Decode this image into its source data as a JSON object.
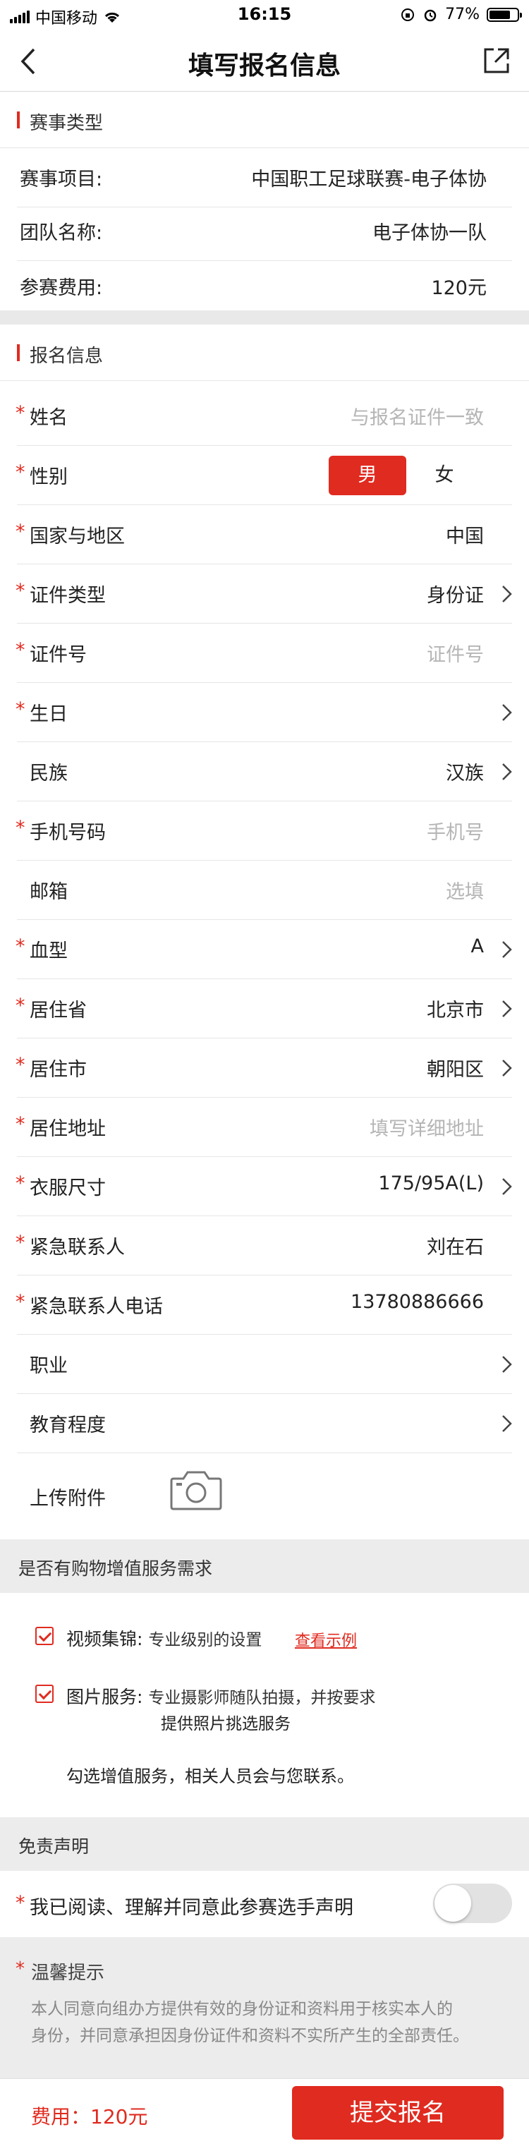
{
  "status_bar": {
    "carrier": "中国移动",
    "time": "16:15",
    "battery": "77%",
    "battery_level": 0.77
  },
  "nav": {
    "title": "填写报名信息",
    "back_icon": "chevron-left-icon",
    "share_icon": "share-external-icon"
  },
  "event_section": {
    "title": "赛事类型",
    "rows": [
      {
        "label": "赛事项目:",
        "value": "中国职工足球联赛-电子体协"
      },
      {
        "label": "团队名称:",
        "value": "电子体协一队"
      },
      {
        "label": "参赛费用:",
        "value": "120元"
      }
    ]
  },
  "signup_section": {
    "title": "报名信息",
    "required_mark": "*",
    "name": {
      "label": "姓名",
      "placeholder": "与报名证件一致"
    },
    "gender": {
      "label": "性别",
      "options": [
        "男",
        "女"
      ],
      "selected": "男"
    },
    "country": {
      "label": "国家与地区",
      "value": "中国"
    },
    "id_type": {
      "label": "证件类型",
      "value": "身份证"
    },
    "id_number": {
      "label": "证件号",
      "placeholder": "证件号"
    },
    "birthday": {
      "label": "生日",
      "value": ""
    },
    "ethnicity": {
      "label": "民族",
      "value": "汉族"
    },
    "phone": {
      "label": "手机号码",
      "placeholder": "手机号"
    },
    "email": {
      "label": "邮箱",
      "placeholder": "选填"
    },
    "blood_type": {
      "label": "血型",
      "value": "A"
    },
    "province": {
      "label": "居住省",
      "value": "北京市"
    },
    "city": {
      "label": "居住市",
      "value": "朝阳区"
    },
    "address": {
      "label": "居住地址",
      "placeholder": "填写详细地址"
    },
    "clothing_size": {
      "label": "衣服尺寸",
      "value": "175/95A(L)"
    },
    "emergency_contact": {
      "label": "紧急联系人",
      "value": "刘在石"
    },
    "emergency_phone": {
      "label": "紧急联系人电话",
      "value": "13780886666"
    },
    "occupation": {
      "label": "职业",
      "value": ""
    },
    "education": {
      "label": "教育程度",
      "value": ""
    },
    "attachment": {
      "label": "上传附件",
      "icon": "camera-icon"
    }
  },
  "value_added": {
    "title": "是否有购物增值服务需求",
    "video": {
      "key": "视频集锦:",
      "desc": "专业级别的设置",
      "link": "查看示例",
      "checked": true
    },
    "photo": {
      "key": "图片服务:",
      "desc_line1": "专业摄影师随队拍摄，并按要求",
      "desc_line2": "提供照片挑选服务",
      "checked": true
    },
    "note": "勾选增值服务，相关人员会与您联系。"
  },
  "disclaimer": {
    "title": "免责声明",
    "agree_label": "我已阅读、理解并同意此参赛选手声明",
    "agreed": false
  },
  "tip": {
    "title": "温馨提示",
    "line1": "本人同意向组办方提供有效的身份证和资料用于核实本人的",
    "line2": "身份，并同意承担因身份证件和资料不实所产生的全部责任。"
  },
  "footer": {
    "fee": "费用：120元",
    "submit_label": "提交报名"
  },
  "colors": {
    "accent": "#e02b20",
    "placeholder": "#b5b5b5",
    "section_gap": "#e9e9e9"
  }
}
